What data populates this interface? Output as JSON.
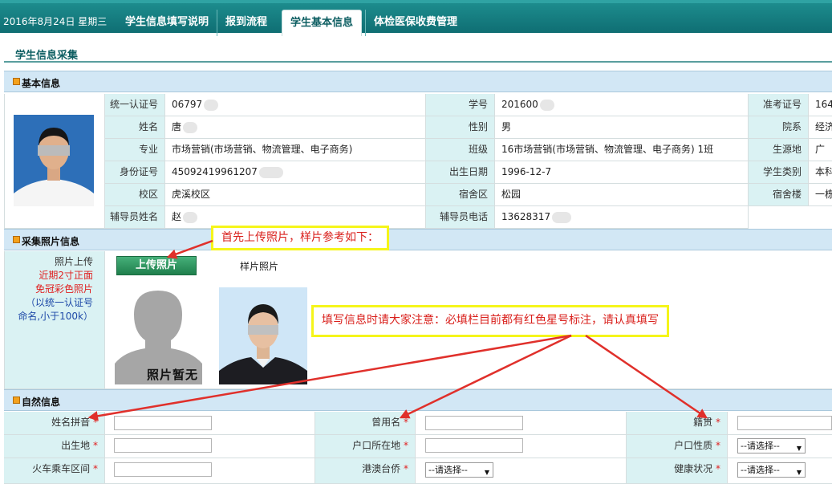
{
  "header": {
    "date": "2016年8月24日 星期三",
    "tabs": [
      "学生信息填写说明",
      "报到流程",
      "学生基本信息",
      "体检医保收费管理"
    ],
    "active_tab": "学生基本信息"
  },
  "page_title": "学生信息采集",
  "basic": {
    "title": "基本信息",
    "rows": [
      {
        "l1": "统一认证号",
        "v1": "06797",
        "l2": "学号",
        "v2": "201600",
        "l3": "准考证号",
        "v3": "164"
      },
      {
        "l1": "姓名",
        "v1": "唐",
        "l2": "性别",
        "v2": "男",
        "l3": "院系",
        "v3": "经济"
      },
      {
        "l1": "专业",
        "v1": "市场营销(市场营销、物流管理、电子商务)",
        "l2": "班级",
        "v2": "16市场营销(市场营销、物流管理、电子商务) 1班",
        "l3": "生源地",
        "v3": "广"
      },
      {
        "l1": "身份证号",
        "v1": "45092419961207",
        "l2": "出生日期",
        "v2": "1996-12-7",
        "l3": "学生类别",
        "v3": "本科"
      },
      {
        "l1": "校区",
        "v1": "虎溪校区",
        "l2": "宿舍区",
        "v2": "松园",
        "l3": "宿舍楼",
        "v3": "一栋"
      },
      {
        "l1": "辅导员姓名",
        "v1": "赵",
        "l2": "辅导员电话",
        "v2": "13628317",
        "l3": "",
        "v3": ""
      }
    ]
  },
  "photo": {
    "title": "采集照片信息",
    "upload_label": "照片上传",
    "note_red_1": "近期2寸正面",
    "note_red_2": "免冠彩色照片",
    "note_blue_1": "（以统一认证号",
    "note_blue_2": "命名,小于100k）",
    "upload_button": "上传照片",
    "sample_label": "样片照片",
    "placeholder_text": "照片暂无"
  },
  "annotations": {
    "callout1": "首先上传照片，样片参考如下：",
    "callout2": "填写信息时请大家注意：必填栏目前都有红色星号标注，请认真填写"
  },
  "natural": {
    "title": "自然信息",
    "required_mark": "*",
    "rows": [
      {
        "l1": "姓名拼音",
        "l2": "曾用名",
        "l3": "籍贯"
      },
      {
        "l1": "出生地",
        "l2": "户口所在地",
        "l3": "户口性质"
      },
      {
        "l1": "火车乘车区间",
        "l2": "港澳台侨",
        "l3": "健康状况"
      }
    ],
    "select_placeholder": "--请选择--"
  },
  "colors": {
    "nav": "#127a7d",
    "label_bg": "#daf2f3",
    "section_bg": "#d2e7f5",
    "required": "#e02020",
    "annotation_red": "#d9201c",
    "callout_border": "#f5f51a"
  }
}
